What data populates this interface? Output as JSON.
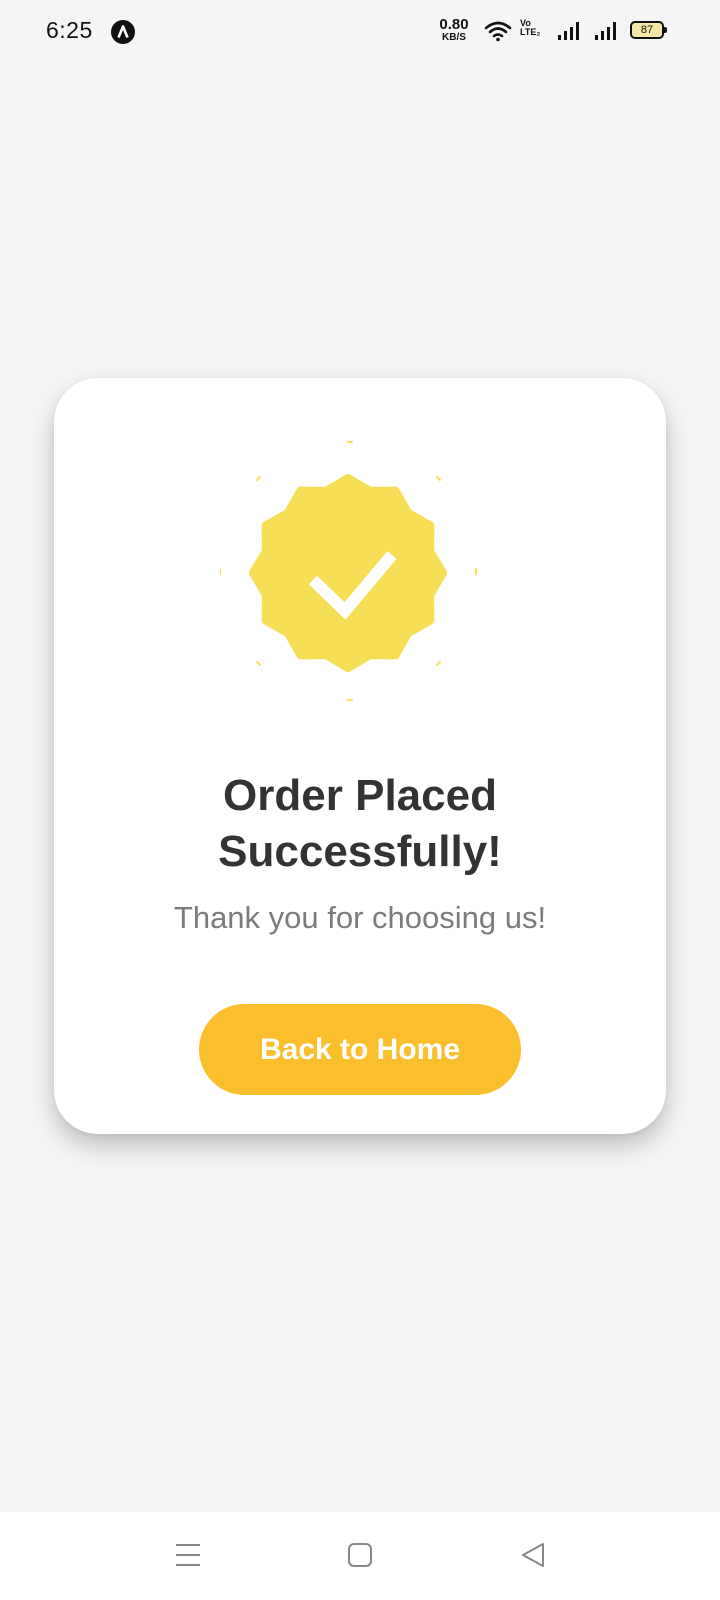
{
  "status_bar": {
    "time": "6:25",
    "net_speed_value": "0.80",
    "net_speed_unit": "KB/S",
    "volte_top": "Vo",
    "volte_bottom": "LTE₂",
    "battery_level": "87"
  },
  "card": {
    "title_line1": "Order Placed",
    "title_line2": "Successfully!",
    "subtitle": "Thank you for choosing us!",
    "button_label": "Back to Home"
  },
  "colors": {
    "background": "#f5f5f5",
    "badge": "#f6df55",
    "button": "#fbbf2d",
    "title": "#333333",
    "subtitle": "#7c7c7c"
  },
  "icons": {
    "app_badge": "app-logo-icon",
    "wifi": "wifi-icon",
    "signal": "signal-icon",
    "battery": "battery-icon",
    "success_badge": "success-badge-icon",
    "check": "checkmark-icon",
    "nav_menu": "menu-icon",
    "nav_home": "square-home-icon",
    "nav_back": "triangle-back-icon"
  }
}
